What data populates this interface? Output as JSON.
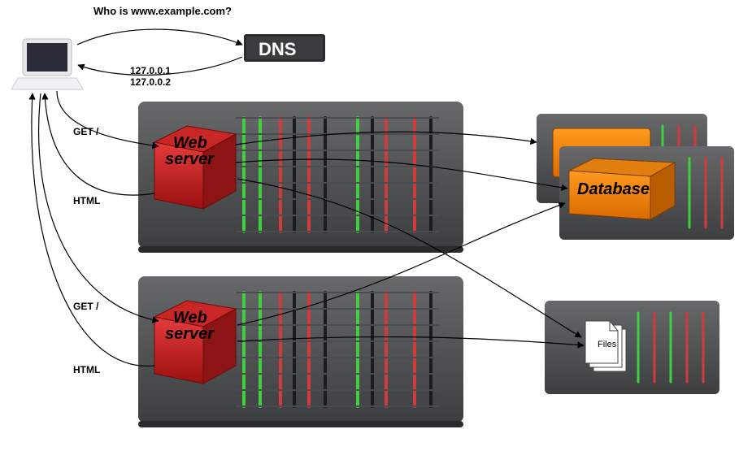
{
  "dns": {
    "box_label": "DNS",
    "query_label": "Who is www.example.com?",
    "answers": [
      "127.0.0.1",
      "127.0.0.2"
    ]
  },
  "client": {
    "icon": "laptop-icon"
  },
  "web_servers": [
    {
      "cube_label_line1": "Web",
      "cube_label_line2": "server",
      "request_label": "GET /",
      "response_label": "HTML"
    },
    {
      "cube_label_line1": "Web",
      "cube_label_line2": "server",
      "request_label": "GET /",
      "response_label": "HTML"
    }
  ],
  "database": {
    "label": "Database"
  },
  "files": {
    "label": "Files"
  }
}
